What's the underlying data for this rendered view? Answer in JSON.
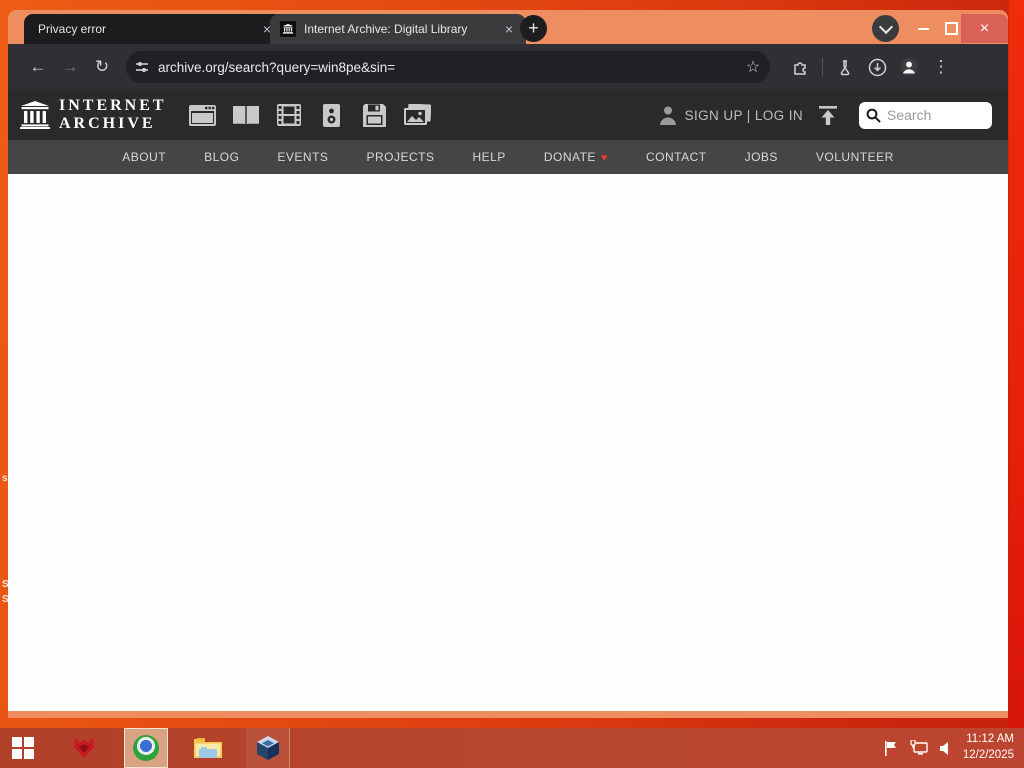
{
  "desktop": {
    "icon_label_fragments": [
      "s",
      "S",
      "S"
    ]
  },
  "browser": {
    "tabs": [
      {
        "title": "Privacy error",
        "active": false
      },
      {
        "title": "Internet Archive: Digital Library",
        "active": true
      }
    ],
    "glyphs": {
      "close": "×",
      "plus": "+",
      "back": "←",
      "forward": "→",
      "reload": "↻",
      "star": "☆",
      "menu": "⋮"
    },
    "toolbar": {
      "url": "archive.org/search?query=win8pe&sin="
    }
  },
  "page": {
    "logo_line1": "INTERNET",
    "logo_line2": "ARCHIVE",
    "media_types": [
      "web",
      "texts",
      "video",
      "audio",
      "software",
      "images"
    ],
    "account_text": "SIGN UP | LOG IN",
    "search_placeholder": "Search",
    "heart_glyph": "♥",
    "nav": [
      {
        "label": "ABOUT"
      },
      {
        "label": "BLOG"
      },
      {
        "label": "EVENTS"
      },
      {
        "label": "PROJECTS"
      },
      {
        "label": "HELP"
      },
      {
        "label": "DONATE",
        "heart": true
      },
      {
        "label": "CONTACT"
      },
      {
        "label": "JOBS"
      },
      {
        "label": "VOLUNTEER"
      }
    ]
  },
  "taskbar": {
    "clock_time": "11:12 AM",
    "clock_date": "12/2/2025",
    "colors": {
      "bar": "#b8462e",
      "active_app_bg": "#d9a283"
    }
  }
}
